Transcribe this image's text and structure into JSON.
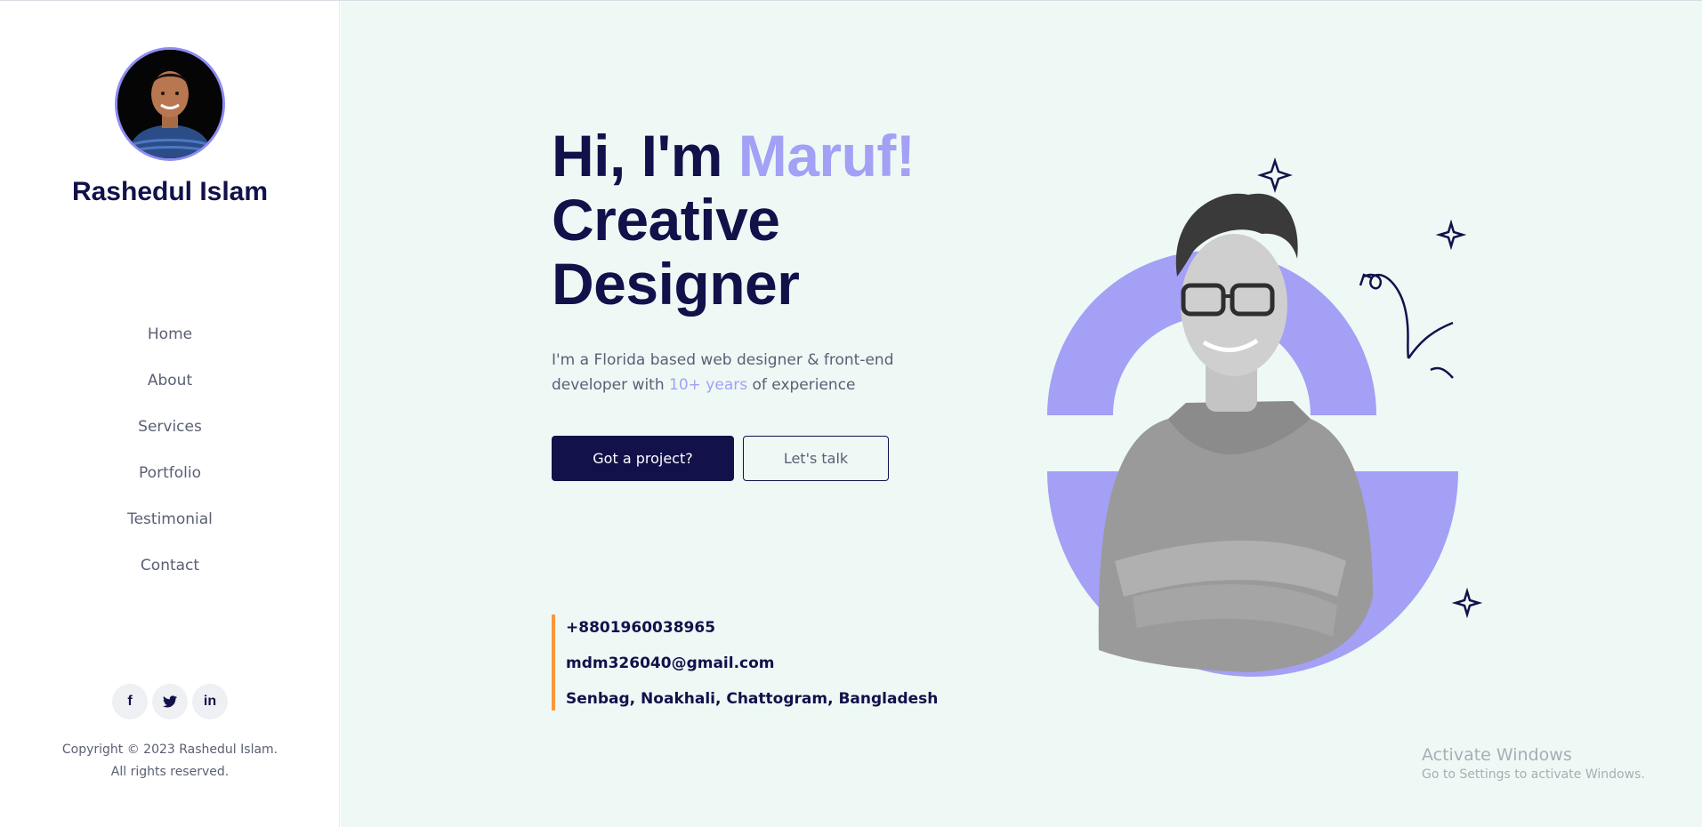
{
  "profile": {
    "name": "Rashedul Islam"
  },
  "nav": [
    {
      "label": "Home"
    },
    {
      "label": "About"
    },
    {
      "label": "Services"
    },
    {
      "label": "Portfolio"
    },
    {
      "label": "Testimonial"
    },
    {
      "label": "Contact"
    }
  ],
  "social": [
    {
      "icon": "facebook-icon",
      "glyph": "f"
    },
    {
      "icon": "twitter-icon",
      "glyph": "🐦"
    },
    {
      "icon": "linkedin-icon",
      "glyph": "in"
    }
  ],
  "footer": {
    "copyright_line1": "Copyright © 2023 Rashedul Islam.",
    "copyright_line2": "All rights reserved."
  },
  "hero": {
    "greeting": "Hi, I'm ",
    "name_accent": "Maruf!",
    "title_line2": "Creative",
    "title_line3": "Designer",
    "desc_part1": "I'm a Florida based web designer & front-end developer with ",
    "desc_highlight": "10+ years",
    "desc_part2": " of experience",
    "primary_button": "Got a project?",
    "secondary_button": "Let's talk"
  },
  "contact": {
    "phone": "+8801960038965",
    "email": "mdm326040@gmail.com",
    "address": "Senbag, Noakhali, Chattogram, Bangladesh"
  },
  "watermark": {
    "title": "Activate Windows",
    "subtitle": "Go to Settings to activate Windows."
  },
  "colors": {
    "primary": "#12114a",
    "accent": "#a3a0f6",
    "contact_bar": "#f7993c",
    "main_bg": "#eef9f6"
  }
}
